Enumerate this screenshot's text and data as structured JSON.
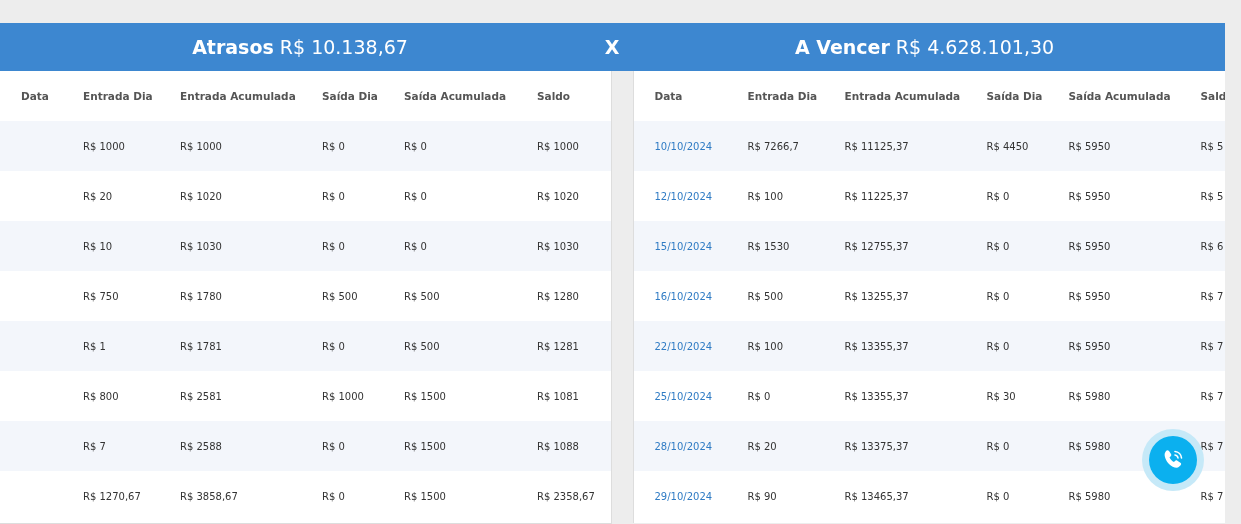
{
  "header": {
    "left_title": "**Atrasos** R$ 10.138,67",
    "separator": "X",
    "right_title": "**A Vencer** R$ 4.628.101,30"
  },
  "overdue_table": {
    "columns": [
      "Data",
      "Entrada Dia",
      "Entrada Acumulada",
      "Saída Dia",
      "Saída Acumulada",
      "Saldo"
    ],
    "rows": [
      {
        "cells": [
          "",
          "R$ 1000",
          "R$ 1000",
          "R$ 0",
          "R$ 0",
          "R$ 1000"
        ]
      },
      {
        "cells": [
          "",
          "R$ 20",
          "R$ 1020",
          "R$ 0",
          "R$ 0",
          "R$ 1020"
        ]
      },
      {
        "cells": [
          "",
          "R$ 10",
          "R$ 1030",
          "R$ 0",
          "R$ 0",
          "R$ 1030"
        ]
      },
      {
        "cells": [
          "",
          "R$ 750",
          "R$ 1780",
          "R$ 500",
          "R$ 500",
          "R$ 1280"
        ]
      },
      {
        "cells": [
          "",
          "R$ 1",
          "R$ 1781",
          "R$ 0",
          "R$ 500",
          "R$ 1281"
        ]
      },
      {
        "cells": [
          "",
          "R$ 800",
          "R$ 2581",
          "R$ 1000",
          "R$ 1500",
          "R$ 1081"
        ]
      },
      {
        "cells": [
          "",
          "R$ 7",
          "R$ 2588",
          "R$ 0",
          "R$ 1500",
          "R$ 1088"
        ]
      },
      {
        "cells": [
          "",
          "R$ 1270,67",
          "R$ 3858,67",
          "R$ 0",
          "R$ 1500",
          "R$ 2358,67"
        ]
      }
    ]
  },
  "upcoming_table": {
    "columns": [
      "Data",
      "Entrada Dia",
      "Entrada Acumulada",
      "Saída Dia",
      "Saída Acumulada",
      "Sald"
    ],
    "rows": [
      {
        "cells": [
          "10/10/2024",
          "R$ 7266,7",
          "R$ 11125,37",
          "R$ 4450",
          "R$ 5950",
          "R$ 5"
        ]
      },
      {
        "cells": [
          "12/10/2024",
          "R$ 100",
          "R$ 11225,37",
          "R$ 0",
          "R$ 5950",
          "R$ 5"
        ]
      },
      {
        "cells": [
          "15/10/2024",
          "R$ 1530",
          "R$ 12755,37",
          "R$ 0",
          "R$ 5950",
          "R$ 6"
        ]
      },
      {
        "cells": [
          "16/10/2024",
          "R$ 500",
          "R$ 13255,37",
          "R$ 0",
          "R$ 5950",
          "R$ 7"
        ]
      },
      {
        "cells": [
          "22/10/2024",
          "R$ 100",
          "R$ 13355,37",
          "R$ 0",
          "R$ 5950",
          "R$ 7"
        ]
      },
      {
        "cells": [
          "25/10/2024",
          "R$ 0",
          "R$ 13355,37",
          "R$ 30",
          "R$ 5980",
          "R$ 7"
        ]
      },
      {
        "cells": [
          "28/10/2024",
          "R$ 20",
          "R$ 13375,37",
          "R$ 0",
          "R$ 5980",
          "R$ 7"
        ]
      },
      {
        "cells": [
          "29/10/2024",
          "R$ 90",
          "R$ 13465,37",
          "R$ 0",
          "R$ 5980",
          "R$ 7"
        ]
      }
    ]
  }
}
